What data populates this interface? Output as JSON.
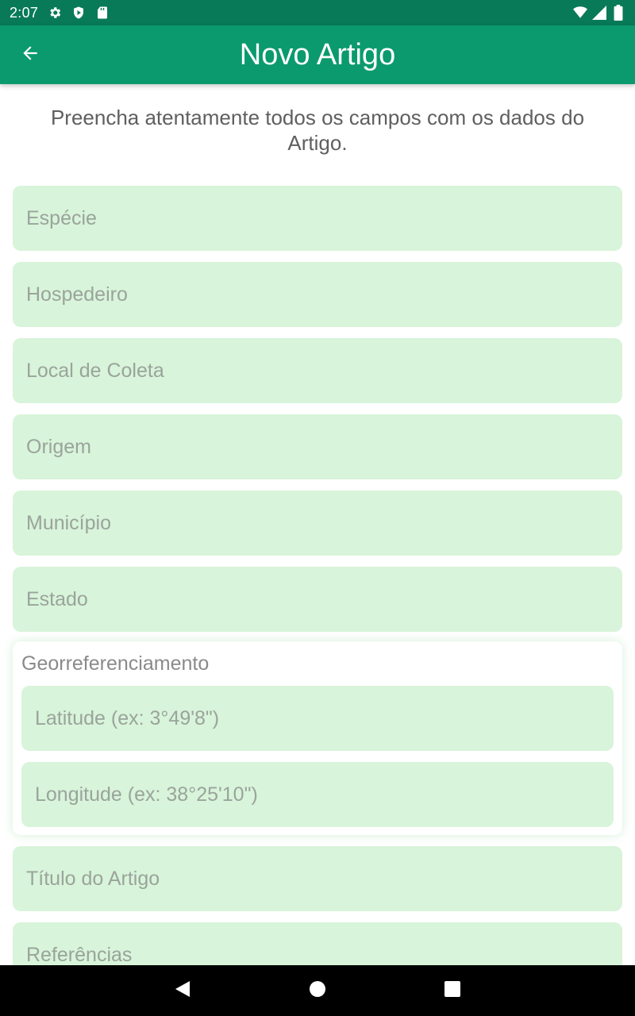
{
  "status_bar": {
    "time": "2:07",
    "icons": [
      "gear-icon",
      "shield-icon",
      "sd-card-icon",
      "wifi-icon",
      "signal-icon",
      "battery-icon"
    ]
  },
  "app_bar": {
    "title": "Novo Artigo",
    "back_icon": "arrow-left-icon",
    "color": "#0b9a6d"
  },
  "form": {
    "intro": "Preencha atentamente todos os campos com os dados do Artigo.",
    "fields": [
      {
        "placeholder": "Espécie"
      },
      {
        "placeholder": "Hospedeiro"
      },
      {
        "placeholder": "Local de Coleta"
      },
      {
        "placeholder": "Origem"
      },
      {
        "placeholder": "Município"
      },
      {
        "placeholder": "Estado"
      }
    ],
    "georef": {
      "label": "Georreferenciamento",
      "latitude_placeholder": "Latitude (ex: 3°49'8\")",
      "longitude_placeholder": "Longitude (ex: 38°25'10\")"
    },
    "fields_after": [
      {
        "placeholder": "Título do Artigo"
      },
      {
        "placeholder": "Referências"
      }
    ],
    "field_color": "#d8f4da"
  },
  "nav_bar": {
    "icons": [
      "back-triangle-icon",
      "home-circle-icon",
      "recents-square-icon"
    ]
  }
}
